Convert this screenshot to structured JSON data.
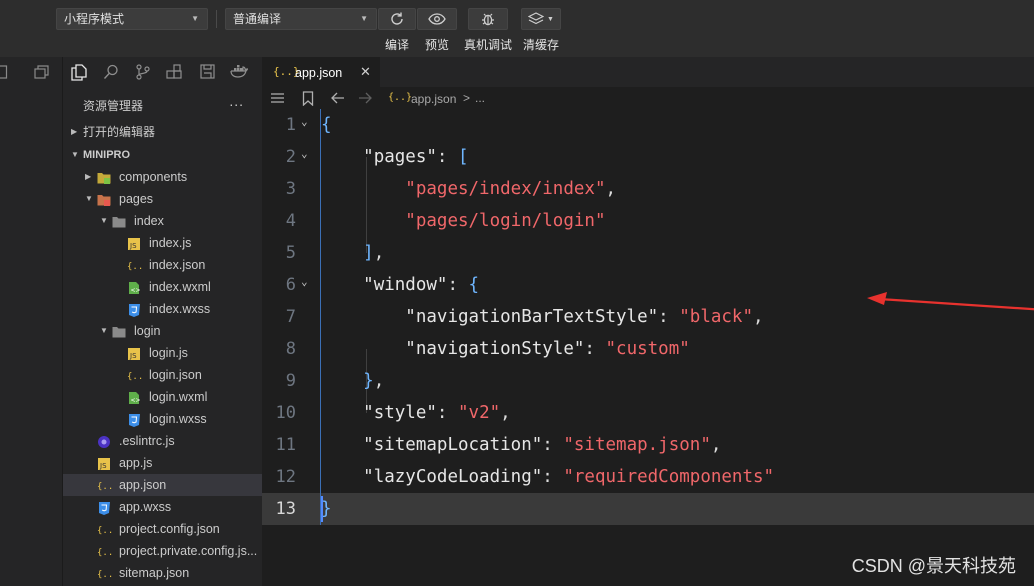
{
  "toolbar": {
    "mode_select": "小程序模式",
    "compile_select": "普通编译",
    "buttons": [
      {
        "label": "编译",
        "icon": "refresh-icon"
      },
      {
        "label": "预览",
        "icon": "eye-icon"
      },
      {
        "label": "真机调试",
        "icon": "bug-icon"
      },
      {
        "label": "清缓存",
        "icon": "layers-icon"
      }
    ]
  },
  "explorer": {
    "title": "资源管理器",
    "more": "...",
    "open_editors_label": "打开的编辑器",
    "project_label": "MINIPRO",
    "tree": [
      {
        "name": "components",
        "type": "folder-components",
        "depth": 1,
        "expanded": false
      },
      {
        "name": "pages",
        "type": "folder-pages",
        "depth": 1,
        "expanded": true
      },
      {
        "name": "index",
        "type": "folder",
        "depth": 2,
        "expanded": true
      },
      {
        "name": "index.js",
        "type": "js",
        "depth": 3
      },
      {
        "name": "index.json",
        "type": "json",
        "depth": 3
      },
      {
        "name": "index.wxml",
        "type": "wxml",
        "depth": 3
      },
      {
        "name": "index.wxss",
        "type": "wxss",
        "depth": 3
      },
      {
        "name": "login",
        "type": "folder",
        "depth": 2,
        "expanded": true
      },
      {
        "name": "login.js",
        "type": "js",
        "depth": 3
      },
      {
        "name": "login.json",
        "type": "json",
        "depth": 3
      },
      {
        "name": "login.wxml",
        "type": "wxml",
        "depth": 3
      },
      {
        "name": "login.wxss",
        "type": "wxss",
        "depth": 3
      },
      {
        "name": ".eslintrc.js",
        "type": "eslint",
        "depth": 1
      },
      {
        "name": "app.js",
        "type": "js",
        "depth": 1
      },
      {
        "name": "app.json",
        "type": "json",
        "depth": 1,
        "selected": true
      },
      {
        "name": "app.wxss",
        "type": "wxss",
        "depth": 1
      },
      {
        "name": "project.config.json",
        "type": "json",
        "depth": 1
      },
      {
        "name": "project.private.config.js...",
        "type": "json",
        "depth": 1
      },
      {
        "name": "sitemap.json",
        "type": "json",
        "depth": 1
      }
    ]
  },
  "editor": {
    "tab": {
      "icon_text": "{..}",
      "name": "app.json",
      "close": "✕"
    },
    "breadcrumb": {
      "icon_text": "{..}",
      "file": "app.json",
      "sep": ">",
      "more": "..."
    },
    "current_line": 13,
    "lines": [
      {
        "n": "1",
        "fold": true,
        "tokens": [
          {
            "t": "{",
            "c": "b"
          }
        ]
      },
      {
        "n": "2",
        "fold": true,
        "tokens": [
          {
            "t": "    ",
            "c": "p"
          },
          {
            "t": "\"pages\"",
            "c": "k"
          },
          {
            "t": ": ",
            "c": "p"
          },
          {
            "t": "[",
            "c": "b"
          }
        ]
      },
      {
        "n": "3",
        "tokens": [
          {
            "t": "        ",
            "c": "p"
          },
          {
            "t": "\"pages/index/index\"",
            "c": "s"
          },
          {
            "t": ",",
            "c": "p"
          }
        ]
      },
      {
        "n": "4",
        "tokens": [
          {
            "t": "        ",
            "c": "p"
          },
          {
            "t": "\"pages/login/login\"",
            "c": "s"
          }
        ]
      },
      {
        "n": "5",
        "tokens": [
          {
            "t": "    ",
            "c": "p"
          },
          {
            "t": "]",
            "c": "b"
          },
          {
            "t": ",",
            "c": "p"
          }
        ]
      },
      {
        "n": "6",
        "fold": true,
        "tokens": [
          {
            "t": "    ",
            "c": "p"
          },
          {
            "t": "\"window\"",
            "c": "k"
          },
          {
            "t": ": ",
            "c": "p"
          },
          {
            "t": "{",
            "c": "b"
          }
        ]
      },
      {
        "n": "7",
        "tokens": [
          {
            "t": "        ",
            "c": "p"
          },
          {
            "t": "\"navigationBarTextStyle\"",
            "c": "k"
          },
          {
            "t": ": ",
            "c": "p"
          },
          {
            "t": "\"black\"",
            "c": "s"
          },
          {
            "t": ",",
            "c": "p"
          }
        ]
      },
      {
        "n": "8",
        "tokens": [
          {
            "t": "        ",
            "c": "p"
          },
          {
            "t": "\"navigationStyle\"",
            "c": "k"
          },
          {
            "t": ": ",
            "c": "p"
          },
          {
            "t": "\"custom\"",
            "c": "s"
          }
        ]
      },
      {
        "n": "9",
        "tokens": [
          {
            "t": "    ",
            "c": "p"
          },
          {
            "t": "}",
            "c": "b"
          },
          {
            "t": ",",
            "c": "p"
          }
        ]
      },
      {
        "n": "10",
        "tokens": [
          {
            "t": "    ",
            "c": "p"
          },
          {
            "t": "\"style\"",
            "c": "k"
          },
          {
            "t": ": ",
            "c": "p"
          },
          {
            "t": "\"v2\"",
            "c": "s"
          },
          {
            "t": ",",
            "c": "p"
          }
        ]
      },
      {
        "n": "11",
        "tokens": [
          {
            "t": "    ",
            "c": "p"
          },
          {
            "t": "\"sitemapLocation\"",
            "c": "k"
          },
          {
            "t": ": ",
            "c": "p"
          },
          {
            "t": "\"sitemap.json\"",
            "c": "s"
          },
          {
            "t": ",",
            "c": "p"
          }
        ]
      },
      {
        "n": "12",
        "tokens": [
          {
            "t": "    ",
            "c": "p"
          },
          {
            "t": "\"lazyCodeLoading\"",
            "c": "k"
          },
          {
            "t": ": ",
            "c": "p"
          },
          {
            "t": "\"requiredComponents\"",
            "c": "s"
          }
        ]
      },
      {
        "n": "13",
        "tokens": [
          {
            "t": "}",
            "c": "b"
          }
        ]
      }
    ]
  },
  "annotation_arrow_color": "#e8322e",
  "watermark": "CSDN @景天科技苑"
}
